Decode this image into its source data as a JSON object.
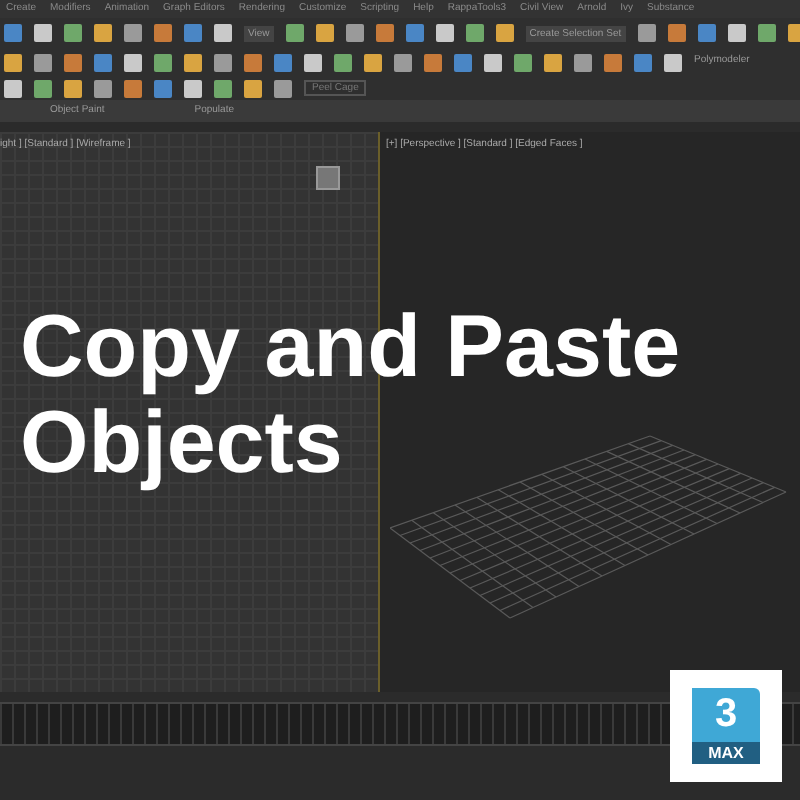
{
  "menu_bar": [
    "Create",
    "Modifiers",
    "Animation",
    "Graph Editors",
    "Rendering",
    "Customize",
    "Scripting",
    "Help",
    "RappaTools3",
    "Civil View",
    "Arnold",
    "Ivy",
    "Substance"
  ],
  "toolbar": {
    "dropdowns": [
      "View",
      "Create Selection Set"
    ],
    "button": "Peel Cage",
    "ribbon_tab": "Polymodeler"
  },
  "ribbon_tabs": [
    "Object Paint",
    "Populate"
  ],
  "viewports": [
    {
      "label": "ight ] [Standard ] [Wireframe ]"
    },
    {
      "label": "[+] [Perspective ] [Standard ] [Edged Faces ]"
    }
  ],
  "headline": "Copy and Paste Objects",
  "logo": {
    "number": "3",
    "word": "MAX"
  }
}
